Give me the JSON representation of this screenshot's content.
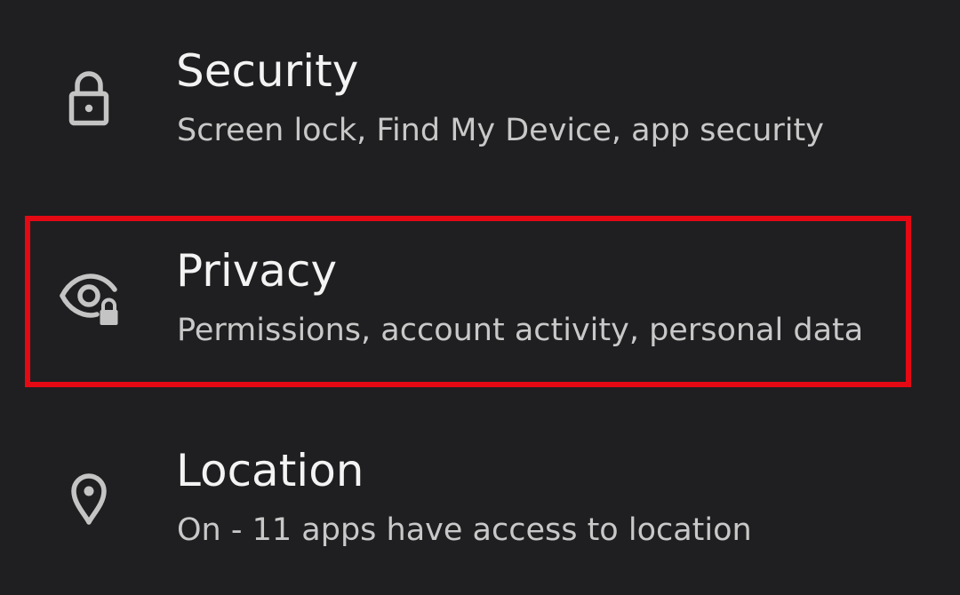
{
  "settings": {
    "items": [
      {
        "id": "security",
        "title": "Security",
        "summary": "Screen lock, Find My Device, app security",
        "icon": "lock-icon"
      },
      {
        "id": "privacy",
        "title": "Privacy",
        "summary": "Permissions, account activity, personal data",
        "icon": "eye-lock-icon"
      },
      {
        "id": "location",
        "title": "Location",
        "summary": "On - 11 apps have access to location",
        "icon": "location-pin-icon"
      }
    ]
  },
  "annotation": {
    "highlighted_item": "privacy",
    "color": "#e50914"
  },
  "colors": {
    "background": "#1f1f21",
    "title_text": "#f3f3f3",
    "summary_text": "#c8c8c8",
    "icon": "#c4c4c4"
  }
}
